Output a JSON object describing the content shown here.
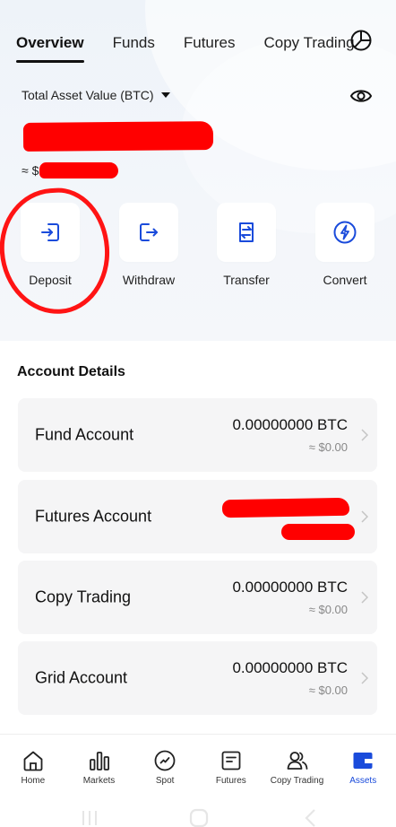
{
  "tabs": [
    "Overview",
    "Funds",
    "Futures",
    "Copy Trading"
  ],
  "header": {
    "total_asset_label": "Total Asset Value (BTC)",
    "approx_prefix": "≈ $"
  },
  "actions": [
    {
      "label": "Deposit",
      "icon": "deposit-icon"
    },
    {
      "label": "Withdraw",
      "icon": "withdraw-icon"
    },
    {
      "label": "Transfer",
      "icon": "transfer-icon"
    },
    {
      "label": "Convert",
      "icon": "convert-icon"
    }
  ],
  "account_details": {
    "title": "Account Details",
    "accounts": [
      {
        "name": "Fund Account",
        "amount": "0.00000000 BTC",
        "usd": "≈ $0.00"
      },
      {
        "name": "Futures Account",
        "amount": "",
        "usd": ""
      },
      {
        "name": "Copy Trading",
        "amount": "0.00000000 BTC",
        "usd": "≈ $0.00"
      },
      {
        "name": "Grid Account",
        "amount": "0.00000000 BTC",
        "usd": "≈ $0.00"
      }
    ]
  },
  "bottom_nav": [
    {
      "label": "Home",
      "icon": "home-icon"
    },
    {
      "label": "Markets",
      "icon": "markets-icon"
    },
    {
      "label": "Spot",
      "icon": "spot-icon"
    },
    {
      "label": "Futures",
      "icon": "futures-icon"
    },
    {
      "label": "Copy Trading",
      "icon": "copy-trading-icon"
    },
    {
      "label": "Assets",
      "icon": "assets-icon",
      "active": true
    }
  ],
  "colors": {
    "accent_blue": "#1a4bdb",
    "annotation_red": "#ff0000"
  }
}
